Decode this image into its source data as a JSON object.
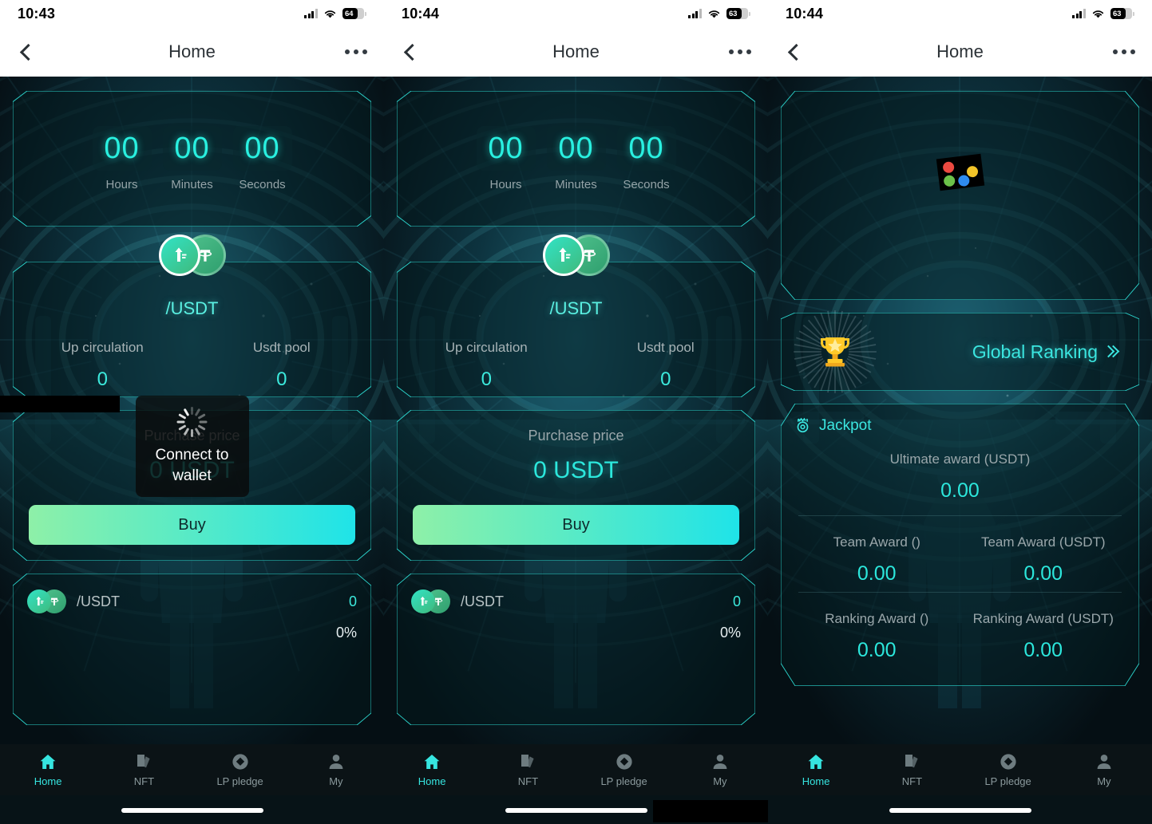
{
  "app": {
    "accent": "#36e5e0",
    "bg": "#06141a"
  },
  "screens": [
    {
      "id": "screen-1",
      "status": {
        "time": "10:43",
        "battery": "64",
        "signal_icon": "cellular-signal-icon",
        "wifi_icon": "wifi-icon",
        "battery_icon": "battery-icon"
      },
      "nav": {
        "back_icon": "back-chevron-icon",
        "title": "Home",
        "more_icon": "more-options-icon"
      },
      "countdown": {
        "units": [
          {
            "value": "00",
            "label": "Hours"
          },
          {
            "value": "00",
            "label": "Minutes"
          },
          {
            "value": "00",
            "label": "Seconds"
          }
        ]
      },
      "pool": {
        "pair": "/USDT",
        "coin_left_icon": "token-coin-icon",
        "coin_right_icon": "usdt-tether-icon",
        "stats": [
          {
            "label": "Up circulation",
            "value": "0"
          },
          {
            "label": "Usdt pool",
            "value": "0"
          }
        ]
      },
      "purchase": {
        "label": "Purchase price",
        "value": "0 USDT",
        "buy_label": "Buy"
      },
      "list": [
        {
          "pair": "/USDT",
          "amount": "0",
          "percent": "0%"
        }
      ],
      "toast": {
        "text": "Connect to wallet",
        "spinner_icon": "loading-spinner-icon"
      },
      "tabbar": {
        "items": [
          {
            "label": "Home",
            "icon": "home-icon",
            "active": true
          },
          {
            "label": "NFT",
            "icon": "nft-cards-icon",
            "active": false
          },
          {
            "label": "LP pledge",
            "icon": "lp-pledge-diamond-icon",
            "active": false
          },
          {
            "label": "My",
            "icon": "user-profile-icon",
            "active": false
          }
        ]
      }
    },
    {
      "id": "screen-2",
      "status": {
        "time": "10:44",
        "battery": "63",
        "signal_icon": "cellular-signal-icon",
        "wifi_icon": "wifi-icon",
        "battery_icon": "battery-icon"
      },
      "nav": {
        "back_icon": "back-chevron-icon",
        "title": "Home",
        "more_icon": "more-options-icon"
      },
      "countdown": {
        "units": [
          {
            "value": "00",
            "label": "Hours"
          },
          {
            "value": "00",
            "label": "Minutes"
          },
          {
            "value": "00",
            "label": "Seconds"
          }
        ]
      },
      "pool": {
        "pair": "/USDT",
        "coin_left_icon": "token-coin-icon",
        "coin_right_icon": "usdt-tether-icon",
        "stats": [
          {
            "label": "Up circulation",
            "value": "0"
          },
          {
            "label": "Usdt pool",
            "value": "0"
          }
        ]
      },
      "purchase": {
        "label": "Purchase price",
        "value": "0 USDT",
        "buy_label": "Buy"
      },
      "list": [
        {
          "pair": "/USDT",
          "amount": "0",
          "percent": "0%"
        }
      ],
      "tabbar": {
        "items": [
          {
            "label": "Home",
            "icon": "home-icon",
            "active": true
          },
          {
            "label": "NFT",
            "icon": "nft-cards-icon",
            "active": false
          },
          {
            "label": "LP pledge",
            "icon": "lp-pledge-diamond-icon",
            "active": false
          },
          {
            "label": "My",
            "icon": "user-profile-icon",
            "active": false
          }
        ]
      }
    },
    {
      "id": "screen-3",
      "status": {
        "time": "10:44",
        "battery": "63",
        "signal_icon": "cellular-signal-icon",
        "wifi_icon": "wifi-icon",
        "battery_icon": "battery-icon"
      },
      "nav": {
        "back_icon": "back-chevron-icon",
        "title": "Home",
        "more_icon": "more-options-icon"
      },
      "hero": {
        "broken_image_icon": "broken-image-placeholder-icon"
      },
      "ranking": {
        "label": "Global Ranking",
        "trophy_icon": "gold-trophy-icon",
        "chevron_icon": "double-chevron-right-icon"
      },
      "jackpot": {
        "title": "Jackpot",
        "icon": "jackpot-medal-icon",
        "ultimate": {
          "label": "Ultimate award (USDT)",
          "value": "0.00"
        },
        "rows": [
          [
            {
              "label": "Team Award ()",
              "value": "0.00"
            },
            {
              "label": "Team Award (USDT)",
              "value": "0.00"
            }
          ],
          [
            {
              "label": "Ranking Award ()",
              "value": "0.00"
            },
            {
              "label": "Ranking Award (USDT)",
              "value": "0.00"
            }
          ]
        ]
      },
      "tabbar": {
        "items": [
          {
            "label": "Home",
            "icon": "home-icon",
            "active": true
          },
          {
            "label": "NFT",
            "icon": "nft-cards-icon",
            "active": false
          },
          {
            "label": "LP pledge",
            "icon": "lp-pledge-diamond-icon",
            "active": false
          },
          {
            "label": "My",
            "icon": "user-profile-icon",
            "active": false
          }
        ]
      }
    }
  ]
}
